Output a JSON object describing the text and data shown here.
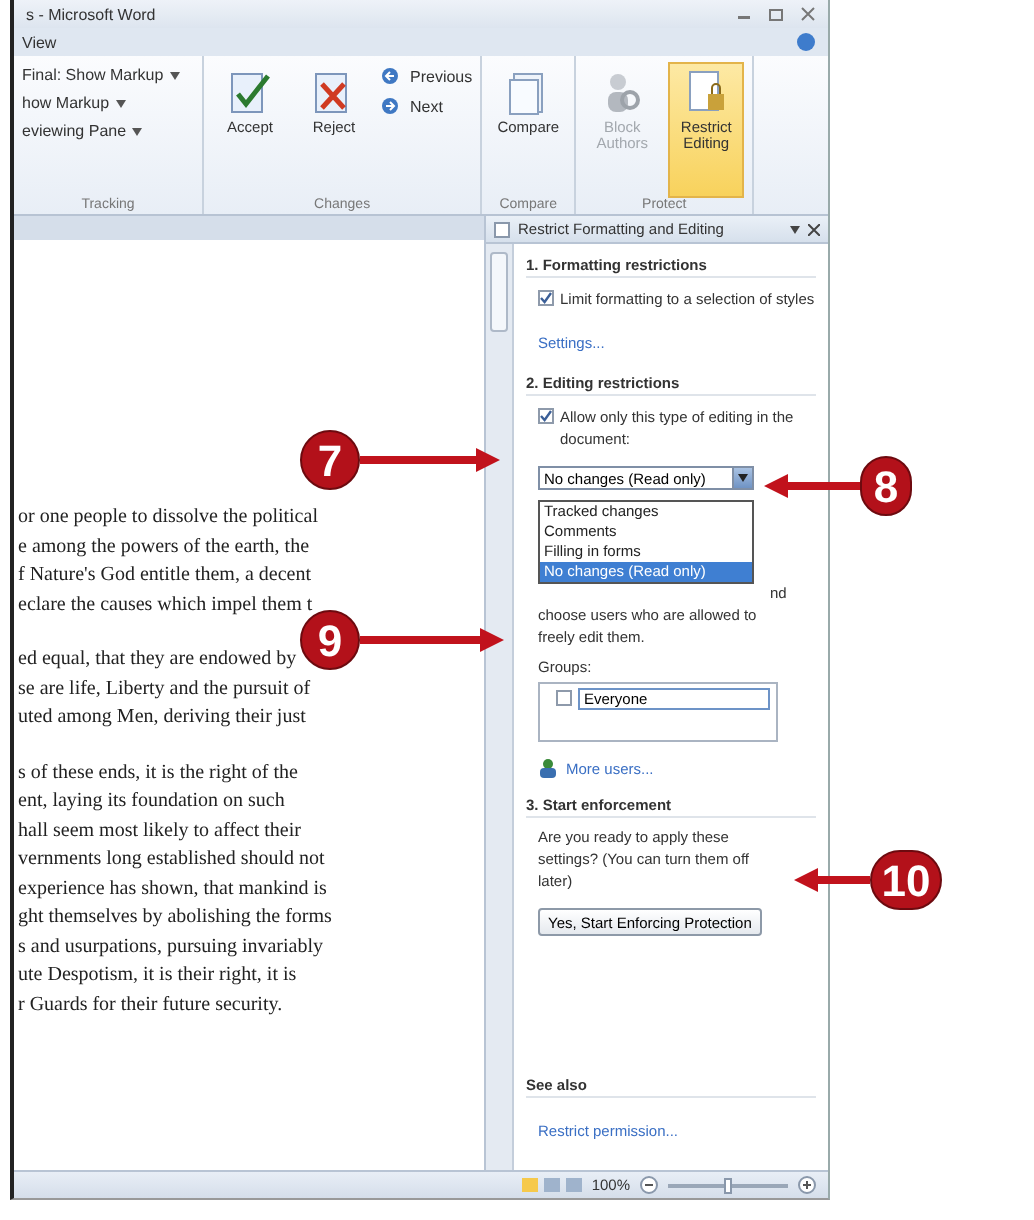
{
  "window": {
    "title": "s - Microsoft Word",
    "tab": "View"
  },
  "ribbon": {
    "groups": [
      {
        "label": "Tracking",
        "kind": "tracking",
        "items": [
          {
            "label": "Final: Show Markup",
            "dropdown": true
          },
          {
            "label": "how Markup",
            "dropdown": true
          },
          {
            "label": "eviewing Pane",
            "dropdown": true
          }
        ]
      },
      {
        "label": "Changes",
        "kind": "changes",
        "items": [
          {
            "label": "Accept",
            "disabled": false,
            "selected": false
          },
          {
            "label": "Reject",
            "disabled": false,
            "selected": false
          }
        ],
        "small": [
          {
            "label": "Previous"
          },
          {
            "label": "Next"
          }
        ]
      },
      {
        "label": "Compare",
        "kind": "large",
        "items": [
          {
            "label": "Compare",
            "disabled": false,
            "selected": false
          }
        ]
      },
      {
        "label": "Protect",
        "kind": "large",
        "items": [
          {
            "label": "Block Authors",
            "disabled": true,
            "selected": false
          },
          {
            "label": "Restrict Editing",
            "disabled": false,
            "selected": true
          }
        ]
      }
    ]
  },
  "document": {
    "paragraphs": [
      [
        "or one people to dissolve the political",
        "e among the powers of the earth, the",
        "f Nature's God entitle them, a decent",
        "eclare the causes which impel them t"
      ],
      [
        "ed equal, that they are endowed by",
        "se are life, Liberty and the pursuit of",
        "uted among Men, deriving their just"
      ],
      [
        "s of these ends, it is the right of the",
        "ent, laying its foundation on such",
        "hall seem most likely to affect their",
        "vernments long established should not",
        "experience has shown, that mankind is",
        "ght themselves by abolishing the forms",
        "s and usurpations, pursuing invariably",
        "ute Despotism, it is their right, it is",
        "r Guards for their future security."
      ]
    ]
  },
  "pane": {
    "title": "Restrict Formatting and Editing",
    "section1": {
      "heading": "1. Formatting restrictions",
      "checkbox": {
        "label": "Limit formatting to a selection of styles",
        "checked": true
      },
      "link": "Settings..."
    },
    "section2": {
      "heading": "2. Editing restrictions",
      "checkbox": {
        "label": "Allow only this type of editing in the document:",
        "checked": true
      },
      "select": {
        "value": "No changes (Read only)",
        "expanded": true,
        "options": [
          {
            "label": "Tracked changes",
            "selected": false
          },
          {
            "label": "Comments",
            "selected": false
          },
          {
            "label": "Filling in forms",
            "selected": false
          },
          {
            "label": "No changes (Read only)",
            "selected": true
          }
        ]
      },
      "hidden_tail": "nd",
      "exceptions_text": "choose users who are allowed to freely edit them.",
      "groups_label": "Groups:",
      "groups": [
        {
          "label": "Everyone",
          "checked": false
        }
      ],
      "more_users": "More users..."
    },
    "section3": {
      "heading": "3. Start enforcement",
      "text": "Are you ready to apply these settings? (You can turn them off later)",
      "button": "Yes, Start Enforcing Protection"
    },
    "see_also": {
      "heading": "See also",
      "link": "Restrict permission..."
    }
  },
  "status_bar": {
    "zoom": "100%",
    "slider": {
      "level": 0.5
    }
  },
  "callouts": [
    {
      "number": "7"
    },
    {
      "number": "8"
    },
    {
      "number": "9"
    },
    {
      "number": "10"
    }
  ]
}
